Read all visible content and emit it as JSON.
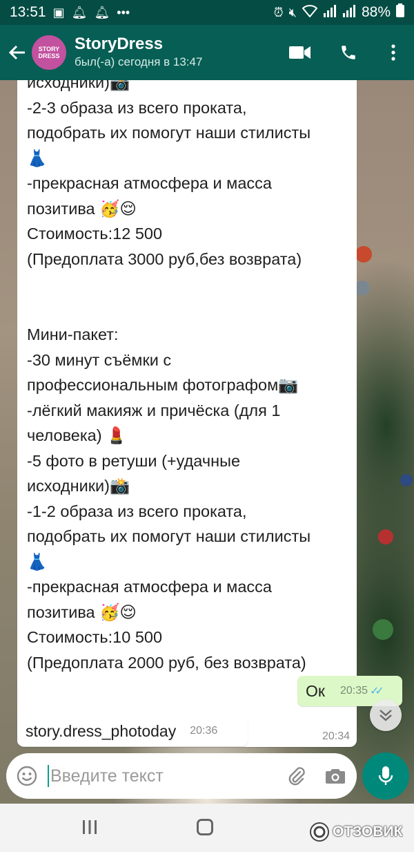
{
  "status_bar": {
    "time": "13:51",
    "battery": "88%"
  },
  "header": {
    "contact_name": "StoryDress",
    "last_seen": "был(-а) сегодня в 13:47",
    "avatar_text_line1": "STORY",
    "avatar_text_line2": "DRESS"
  },
  "message_in": {
    "lines": [
      "исходники)📸",
      "-2-3 образа из всего проката,",
      "подобрать их помогут наши стилисты",
      "👗",
      "-прекрасная атмосфера и масса",
      "позитива 🥳😌",
      "Стоимость:12 500",
      "(Предоплата 3000 руб,без возврата)",
      "",
      "",
      "Мини-пакет:",
      "-30 минут съёмки с",
      "профессиональным фотографом📷",
      "-лёгкий макияж и причёска (для 1",
      "человека) 💄",
      "-5 фото в ретуши (+удачные",
      "исходники)📸",
      "-1-2 образа из всего проката,",
      "подобрать их помогут наши стилисты",
      "👗",
      "-прекрасная атмосфера и масса",
      "позитива 🥳😌",
      "Стоимость:10 500",
      "(Предоплата 2000 руб, без возврата)"
    ],
    "time": "20:34"
  },
  "message_out": {
    "text": "Ок",
    "time": "20:35",
    "ticks": "✓✓"
  },
  "message_link": {
    "text": "story.dress_photoday",
    "time": "20:36"
  },
  "composer": {
    "placeholder": "Введите текст"
  },
  "watermark": {
    "text": "ОТЗОВИК"
  },
  "colors": {
    "header_bg": "#075e54",
    "status_bg": "#054d44",
    "outgoing_bubble": "#dcf8c6",
    "mic_button": "#00897b",
    "read_ticks": "#4fb6ec"
  }
}
